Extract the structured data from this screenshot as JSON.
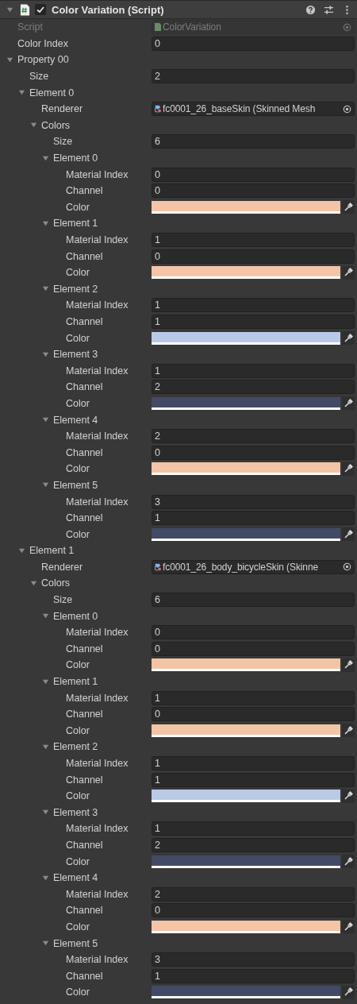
{
  "header": {
    "title": "Color Variation (Script)",
    "expanded": true,
    "enabled": true
  },
  "script": {
    "label": "Script",
    "value": "ColorVariation",
    "disabled": true
  },
  "color_index": {
    "label": "Color Index",
    "value": "0"
  },
  "properties": [
    {
      "label": "Property 00",
      "expanded": true,
      "size_label": "Size",
      "size": "2",
      "elements": [
        {
          "label": "Element 0",
          "expanded": true,
          "renderer_label": "Renderer",
          "renderer": "fc0001_26_baseSkin (Skinned Mesh",
          "colors": {
            "label": "Colors",
            "expanded": true,
            "size_label": "Size",
            "size": "6",
            "items": [
              {
                "label": "Element 0",
                "expanded": true,
                "mi_label": "Material Index",
                "material_index": "0",
                "ch_label": "Channel",
                "channel": "0",
                "color_label": "Color",
                "color": "#f3c4a6"
              },
              {
                "label": "Element 1",
                "expanded": true,
                "mi_label": "Material Index",
                "material_index": "1",
                "ch_label": "Channel",
                "channel": "0",
                "color_label": "Color",
                "color": "#f3c4a6"
              },
              {
                "label": "Element 2",
                "expanded": true,
                "mi_label": "Material Index",
                "material_index": "1",
                "ch_label": "Channel",
                "channel": "1",
                "color_label": "Color",
                "color": "#b9cae6"
              },
              {
                "label": "Element 3",
                "expanded": true,
                "mi_label": "Material Index",
                "material_index": "1",
                "ch_label": "Channel",
                "channel": "2",
                "color_label": "Color",
                "color": "#424a66"
              },
              {
                "label": "Element 4",
                "expanded": true,
                "mi_label": "Material Index",
                "material_index": "2",
                "ch_label": "Channel",
                "channel": "0",
                "color_label": "Color",
                "color": "#f3c4a6"
              },
              {
                "label": "Element 5",
                "expanded": true,
                "mi_label": "Material Index",
                "material_index": "3",
                "ch_label": "Channel",
                "channel": "1",
                "color_label": "Color",
                "color": "#424a66"
              }
            ]
          }
        },
        {
          "label": "Element 1",
          "expanded": true,
          "renderer_label": "Renderer",
          "renderer": "fc0001_26_body_bicycleSkin (Skinne",
          "colors": {
            "label": "Colors",
            "expanded": true,
            "size_label": "Size",
            "size": "6",
            "items": [
              {
                "label": "Element 0",
                "expanded": true,
                "mi_label": "Material Index",
                "material_index": "0",
                "ch_label": "Channel",
                "channel": "0",
                "color_label": "Color",
                "color": "#f3c4a6"
              },
              {
                "label": "Element 1",
                "expanded": true,
                "mi_label": "Material Index",
                "material_index": "1",
                "ch_label": "Channel",
                "channel": "0",
                "color_label": "Color",
                "color": "#f3c4a6"
              },
              {
                "label": "Element 2",
                "expanded": true,
                "mi_label": "Material Index",
                "material_index": "1",
                "ch_label": "Channel",
                "channel": "1",
                "color_label": "Color",
                "color": "#b9cae6"
              },
              {
                "label": "Element 3",
                "expanded": true,
                "mi_label": "Material Index",
                "material_index": "1",
                "ch_label": "Channel",
                "channel": "2",
                "color_label": "Color",
                "color": "#424a66"
              },
              {
                "label": "Element 4",
                "expanded": true,
                "mi_label": "Material Index",
                "material_index": "2",
                "ch_label": "Channel",
                "channel": "0",
                "color_label": "Color",
                "color": "#f3c4a6"
              },
              {
                "label": "Element 5",
                "expanded": true,
                "mi_label": "Material Index",
                "material_index": "3",
                "ch_label": "Channel",
                "channel": "1",
                "color_label": "Color",
                "color": "#424a66"
              }
            ]
          }
        }
      ]
    }
  ]
}
